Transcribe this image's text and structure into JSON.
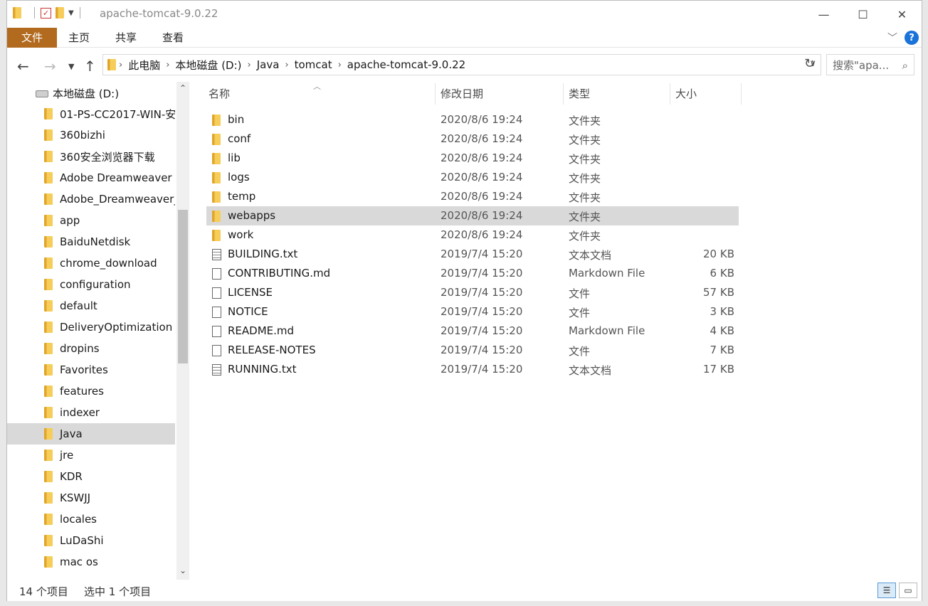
{
  "window": {
    "title": "apache-tomcat-9.0.22",
    "minimize_glyph": "—",
    "maximize_glyph": "☐",
    "close_glyph": "✕"
  },
  "ribbon": {
    "tabs": [
      "文件",
      "主页",
      "共享",
      "查看"
    ],
    "expand_glyph": "﹀",
    "help_glyph": "?"
  },
  "address": {
    "crumbs": [
      "此电脑",
      "本地磁盘 (D:)",
      "Java",
      "tomcat",
      "apache-tomcat-9.0.22"
    ],
    "search_placeholder": "搜索\"apa..."
  },
  "nav": {
    "root": "本地磁盘 (D:)",
    "items": [
      "01-PS-CC2017-WIN-安",
      "360bizhi",
      "360安全浏览器下载",
      "Adobe Dreamweaver C",
      "Adobe_Dreamweaver_",
      "app",
      "BaiduNetdisk",
      "chrome_download",
      "configuration",
      "default",
      "DeliveryOptimization",
      "dropins",
      "Favorites",
      "features",
      "indexer",
      "Java",
      "jre",
      "KDR",
      "KSWJJ",
      "locales",
      "LuDaShi",
      "mac os"
    ],
    "selected": "Java"
  },
  "columns": {
    "name": "名称",
    "date": "修改日期",
    "type": "类型",
    "size": "大小"
  },
  "files": [
    {
      "name": "bin",
      "date": "2020/8/6 19:24",
      "type": "文件夹",
      "size": "",
      "icon": "folder-icon"
    },
    {
      "name": "conf",
      "date": "2020/8/6 19:24",
      "type": "文件夹",
      "size": "",
      "icon": "folder-icon"
    },
    {
      "name": "lib",
      "date": "2020/8/6 19:24",
      "type": "文件夹",
      "size": "",
      "icon": "folder-icon"
    },
    {
      "name": "logs",
      "date": "2020/8/6 19:24",
      "type": "文件夹",
      "size": "",
      "icon": "folder-icon"
    },
    {
      "name": "temp",
      "date": "2020/8/6 19:24",
      "type": "文件夹",
      "size": "",
      "icon": "folder-icon"
    },
    {
      "name": "webapps",
      "date": "2020/8/6 19:24",
      "type": "文件夹",
      "size": "",
      "icon": "folder-icon",
      "selected": true
    },
    {
      "name": "work",
      "date": "2020/8/6 19:24",
      "type": "文件夹",
      "size": "",
      "icon": "folder-icon"
    },
    {
      "name": "BUILDING.txt",
      "date": "2019/7/4 15:20",
      "type": "文本文档",
      "size": "20 KB",
      "icon": "text-file-icon"
    },
    {
      "name": "CONTRIBUTING.md",
      "date": "2019/7/4 15:20",
      "type": "Markdown File",
      "size": "6 KB",
      "icon": "file-icon"
    },
    {
      "name": "LICENSE",
      "date": "2019/7/4 15:20",
      "type": "文件",
      "size": "57 KB",
      "icon": "file-icon"
    },
    {
      "name": "NOTICE",
      "date": "2019/7/4 15:20",
      "type": "文件",
      "size": "3 KB",
      "icon": "file-icon"
    },
    {
      "name": "README.md",
      "date": "2019/7/4 15:20",
      "type": "Markdown File",
      "size": "4 KB",
      "icon": "file-icon"
    },
    {
      "name": "RELEASE-NOTES",
      "date": "2019/7/4 15:20",
      "type": "文件",
      "size": "7 KB",
      "icon": "file-icon"
    },
    {
      "name": "RUNNING.txt",
      "date": "2019/7/4 15:20",
      "type": "文本文档",
      "size": "17 KB",
      "icon": "text-file-icon"
    }
  ],
  "status": {
    "count": "14 个项目",
    "selection": "选中 1 个项目"
  },
  "colors": {
    "file_tab": "#b26a1f",
    "selection": "#d9d9d9",
    "help": "#1a73d9"
  }
}
